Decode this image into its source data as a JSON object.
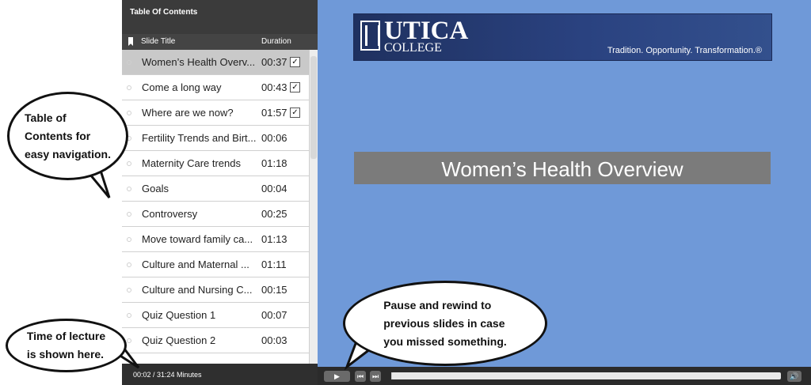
{
  "toc": {
    "title": "Table Of Contents",
    "col_title": "Slide Title",
    "col_duration": "Duration",
    "rows": [
      {
        "title": "Women’s Health Overv...",
        "duration": "00:37",
        "checked": true,
        "active": true
      },
      {
        "title": "Come a long way",
        "duration": "00:43",
        "checked": true,
        "active": false
      },
      {
        "title": "Where are we now?",
        "duration": "01:57",
        "checked": true,
        "active": false
      },
      {
        "title": "Fertility Trends and Birt...",
        "duration": "00:06",
        "checked": false,
        "active": false
      },
      {
        "title": "Maternity Care trends",
        "duration": "01:18",
        "checked": false,
        "active": false
      },
      {
        "title": "Goals",
        "duration": "00:04",
        "checked": false,
        "active": false
      },
      {
        "title": "Controversy",
        "duration": "00:25",
        "checked": false,
        "active": false
      },
      {
        "title": "Move toward family ca...",
        "duration": "01:13",
        "checked": false,
        "active": false
      },
      {
        "title": "Culture and Maternal ...",
        "duration": "01:11",
        "checked": false,
        "active": false
      },
      {
        "title": "Culture and Nursing C...",
        "duration": "00:15",
        "checked": false,
        "active": false
      },
      {
        "title": "Quiz Question 1",
        "duration": "00:07",
        "checked": false,
        "active": false
      },
      {
        "title": "Quiz Question 2",
        "duration": "00:03",
        "checked": false,
        "active": false
      }
    ],
    "time_text": "00:02 / 31:24 Minutes"
  },
  "slide": {
    "logo_utica": "UTICA",
    "logo_college": "COLLEGE",
    "tagline": "Tradition. Opportunity. Transformation.®",
    "title": "Women’s Health Overview"
  },
  "player": {
    "play_symbol": "▶",
    "prev_symbol": "⏮",
    "next_symbol": "⏭",
    "volume_symbol": "🔊",
    "progress_fraction": 0.001
  },
  "callouts": {
    "toc": "Table of\nContents for\neasy navigation.",
    "time": "Time of lecture\nis shown here.",
    "pause": "Pause and rewind to\nprevious slides in case\nyou missed something."
  },
  "colors": {
    "slide_bg": "#6f99d8",
    "sidebar_bg": "#3b3b3b",
    "active_row": "#c9c9c9"
  }
}
